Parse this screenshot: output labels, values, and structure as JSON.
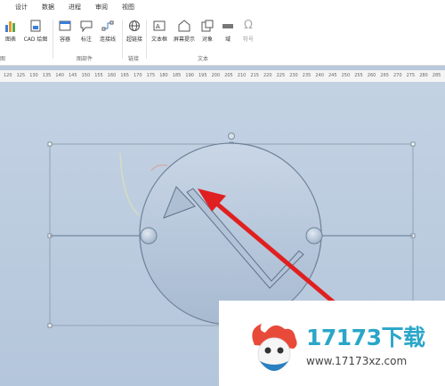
{
  "tabs": [
    "设计",
    "数据",
    "进程",
    "审阅",
    "视图"
  ],
  "ribbon": {
    "buttons": [
      {
        "label": "图表",
        "icon": "chart-icon"
      },
      {
        "label": "CAD 绘图",
        "icon": "cad-drawing-icon"
      },
      {
        "label": "容器",
        "icon": "container-icon"
      },
      {
        "label": "标注",
        "icon": "callout-icon"
      },
      {
        "label": "连接线",
        "icon": "connector-icon"
      },
      {
        "label": "超链接",
        "icon": "hyperlink-icon"
      },
      {
        "label": "文本框",
        "icon": "textbox-icon"
      },
      {
        "label": "屏幕提示",
        "icon": "screentip-icon"
      },
      {
        "label": "对象",
        "icon": "object-icon"
      },
      {
        "label": "域",
        "icon": "field-icon"
      },
      {
        "label": "符号",
        "icon": "omega-symbol-icon"
      }
    ],
    "groups": [
      "图",
      "图部件",
      "链接",
      "文本"
    ],
    "omega": "Ω"
  },
  "ruler": [
    "120",
    "125",
    "130",
    "135",
    "140",
    "145",
    "150",
    "155",
    "160",
    "165",
    "170",
    "175",
    "180",
    "185",
    "190",
    "195",
    "200",
    "205",
    "210",
    "215",
    "220",
    "225",
    "230",
    "235",
    "240",
    "245",
    "250",
    "255",
    "260",
    "265",
    "270",
    "275",
    "280",
    "285"
  ],
  "watermark": {
    "number": "17173下载",
    "url": "www.17173xz.com"
  },
  "colors": {
    "canvas": "#b9c9dc",
    "arrow": "#e02020",
    "accent": "#2aa6c8"
  }
}
